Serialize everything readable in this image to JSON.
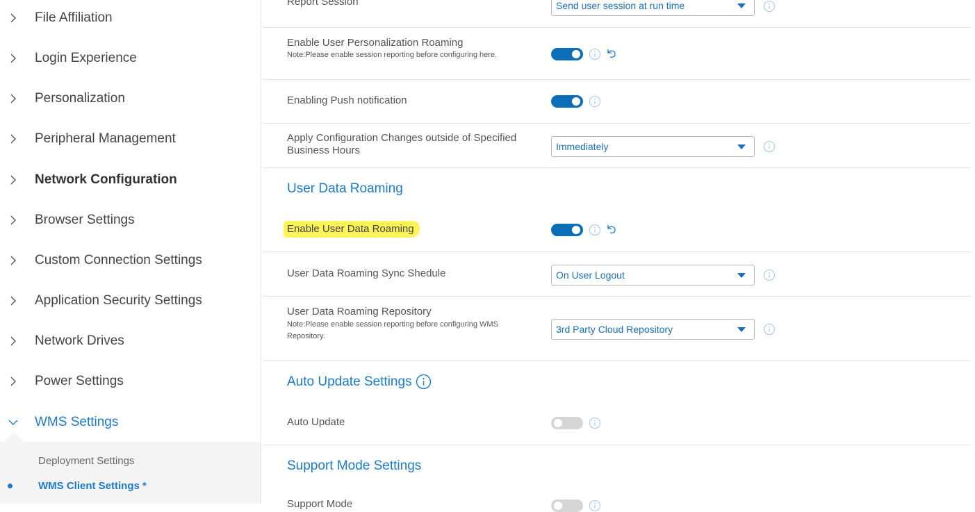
{
  "sidebar": {
    "items": [
      {
        "label": "File Affiliation"
      },
      {
        "label": "Login Experience"
      },
      {
        "label": "Personalization"
      },
      {
        "label": "Peripheral Management"
      },
      {
        "label": "Network Configuration"
      },
      {
        "label": "Browser Settings"
      },
      {
        "label": "Custom Connection Settings"
      },
      {
        "label": "Application Security Settings"
      },
      {
        "label": "Network Drives"
      },
      {
        "label": "Power Settings"
      },
      {
        "label": "WMS Settings"
      }
    ],
    "submenu": [
      {
        "label": "Deployment Settings"
      },
      {
        "label": "WMS Client Settings *"
      }
    ]
  },
  "main": {
    "top_partial": {
      "label": "Report Session",
      "select_value": "Send user session at run time"
    },
    "personalization_roaming": {
      "label": "Enable User Personalization Roaming",
      "note": "Note:Please enable session reporting before configuring here.",
      "enabled": true
    },
    "push_notification": {
      "label": "Enabling Push notification",
      "enabled": true
    },
    "apply_config": {
      "label_line1": "Apply Configuration Changes outside of Specified",
      "label_line2": "Business Hours",
      "select_value": "Immediately"
    },
    "user_data_roaming_section": {
      "title": "User Data Roaming"
    },
    "enable_user_data_roaming": {
      "label": "Enable User Data Roaming",
      "enabled": true
    },
    "sync_schedule": {
      "label": "User Data Roaming Sync Shedule",
      "select_value": "On User Logout"
    },
    "repository": {
      "label": "User Data Roaming Repository",
      "note_line1": "Note:Please enable session reporting before configuring WMS",
      "note_line2": "Repository.",
      "select_value": "3rd Party Cloud Repository"
    },
    "auto_update_section": {
      "title": "Auto Update Settings"
    },
    "auto_update": {
      "label": "Auto Update",
      "enabled": false
    },
    "support_mode_section": {
      "title": "Support Mode Settings"
    },
    "support_mode": {
      "label": "Support Mode",
      "enabled": false
    }
  },
  "colors": {
    "accent": "#1d7ac7",
    "toggle_on": "#0d6eb8",
    "toggle_off": "#d5d5d5",
    "highlight": "#fff35a"
  }
}
